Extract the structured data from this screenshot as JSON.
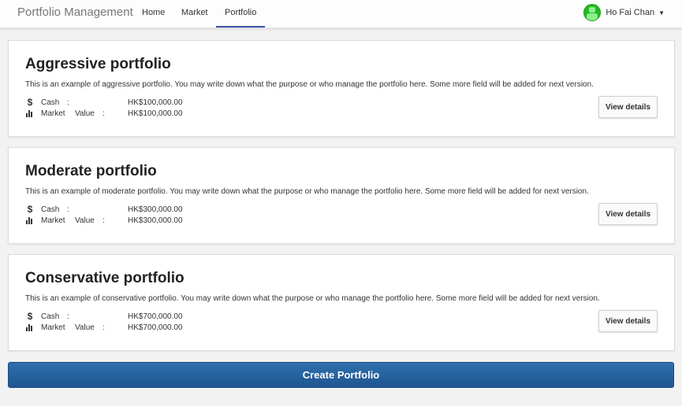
{
  "navbar": {
    "brand": "Portfolio Management",
    "links": [
      "Home",
      "Market",
      "Portfolio"
    ],
    "active": "Portfolio",
    "user_name": "Ho Fai Chan"
  },
  "portfolios": [
    {
      "title": "Aggressive portfolio",
      "description": "This is an example of aggressive portfolio. You may write down what the purpose or who manage the portfolio here. Some more field will be added for next version.",
      "cash_label": "Cash",
      "cash_value": "HK$100,000.00",
      "market_label_1": "Market",
      "market_label_2": "Value",
      "market_value": "HK$100,000.00",
      "button": "View details"
    },
    {
      "title": "Moderate portfolio",
      "description": "This is an example of moderate portfolio. You may write down what the purpose or who manage the portfolio here. Some more field will be added for next version.",
      "cash_label": "Cash",
      "cash_value": "HK$300,000.00",
      "market_label_1": "Market",
      "market_label_2": "Value",
      "market_value": "HK$300,000.00",
      "button": "View details"
    },
    {
      "title": "Conservative portfolio",
      "description": "This is an example of conservative portfolio. You may write down what the purpose or who manage the portfolio here. Some more field will be added for next version.",
      "cash_label": "Cash",
      "cash_value": "HK$700,000.00",
      "market_label_1": "Market",
      "market_label_2": "Value",
      "market_value": "HK$700,000.00",
      "button": "View details"
    }
  ],
  "create_button": "Create Portfolio",
  "colors": {
    "accent": "#3b4fa8",
    "primary_button": "#2a66a3",
    "avatar": "#22bb22"
  },
  "icons": {
    "cash": "dollar-icon",
    "market": "bar-chart-icon",
    "user_menu": "caret-down-icon"
  }
}
